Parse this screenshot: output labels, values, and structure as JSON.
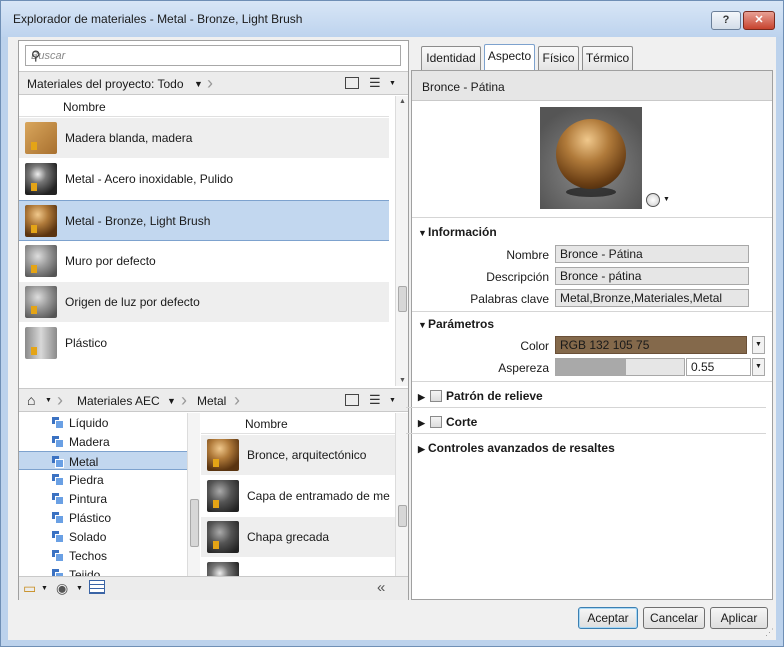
{
  "window": {
    "title": "Explorador de materiales - Metal - Bronze, Light Brush",
    "help_label": "?",
    "close_label": "✕"
  },
  "search": {
    "placeholder": "Buscar"
  },
  "project_bar": {
    "label": "Materiales del proyecto: Todo"
  },
  "project_list": {
    "column_header": "Nombre",
    "items": [
      {
        "label": "Madera blanda, madera",
        "thumb": "wood"
      },
      {
        "label": "Metal - Acero inoxidable, Pulido",
        "thumb": "steel"
      },
      {
        "label": "Metal - Bronze, Light Brush",
        "thumb": "bronze",
        "selected": true
      },
      {
        "label": "Muro por defecto",
        "thumb": "grey"
      },
      {
        "label": "Origen de luz por defecto",
        "thumb": "grey"
      },
      {
        "label": "Plástico",
        "thumb": "plastic"
      }
    ]
  },
  "library_bar": {
    "crumbs": [
      "Materiales AEC",
      "Metal"
    ]
  },
  "library_tree": {
    "items": [
      "Líquido",
      "Madera",
      "Metal",
      "Piedra",
      "Pintura",
      "Plástico",
      "Solado",
      "Techos",
      "Tejido"
    ],
    "selected_index": 2
  },
  "library_list": {
    "column_header": "Nombre",
    "items": [
      {
        "label": "Bronce, arquitectónico",
        "thumb": "bronze"
      },
      {
        "label": "Capa de entramado de me",
        "thumb": "darkmetal"
      },
      {
        "label": "Chapa grecada",
        "thumb": "darkmetal"
      }
    ]
  },
  "tabs": [
    {
      "label": "Identidad",
      "active": false
    },
    {
      "label": "Aspecto",
      "active": true
    },
    {
      "label": "Físico",
      "active": false
    },
    {
      "label": "Térmico",
      "active": false
    }
  ],
  "asset": {
    "name": "Bronce - Pátina"
  },
  "info_section": {
    "title": "Información",
    "fields": [
      {
        "label": "Nombre",
        "value": "Bronce - Pátina"
      },
      {
        "label": "Descripción",
        "value": "Bronce - pátina"
      },
      {
        "label": "Palabras clave",
        "value": "Metal,Bronze,Materiales,Metal"
      }
    ]
  },
  "params_section": {
    "title": "Parámetros",
    "color_label": "Color",
    "color_value": "RGB 132 105 75",
    "color_hex": "#84694b",
    "roughness_label": "Aspereza",
    "roughness_value": "0.55",
    "roughness_fraction": 0.55
  },
  "collapsed_sections": [
    {
      "title": "Patrón de relieve",
      "checkbox": true
    },
    {
      "title": "Corte",
      "checkbox": true
    },
    {
      "title": "Controles avanzados de resaltes",
      "checkbox": false
    }
  ],
  "buttons": {
    "ok": "Aceptar",
    "cancel": "Cancelar",
    "apply": "Aplicar"
  }
}
